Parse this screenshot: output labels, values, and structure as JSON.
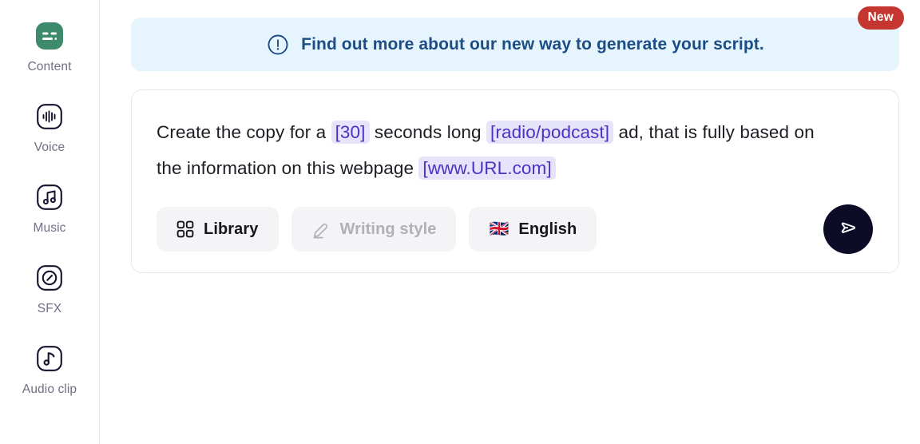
{
  "sidebar": {
    "items": [
      {
        "label": "Content",
        "icon": "content-icon",
        "active": true
      },
      {
        "label": "Voice",
        "icon": "voice-icon",
        "active": false
      },
      {
        "label": "Music",
        "icon": "music-icon",
        "active": false
      },
      {
        "label": "SFX",
        "icon": "sfx-icon",
        "active": false
      },
      {
        "label": "Audio clip",
        "icon": "audio-clip-icon",
        "active": false
      }
    ]
  },
  "banner": {
    "icon": "exclamation-circle-icon",
    "text": "Find out more about our new way to generate your script.",
    "badge": "New",
    "background_color": "#e6f4fd",
    "text_color": "#1c4d85",
    "badge_color": "#c4362f"
  },
  "prompt": {
    "segments": [
      {
        "text": "Create the copy for a ",
        "highlight": false
      },
      {
        "text": "[30]",
        "highlight": true
      },
      {
        "text": " seconds long ",
        "highlight": false
      },
      {
        "text": "[radio/podcast]",
        "highlight": true
      },
      {
        "text": " ad, that is fully based on the information on this webpage ",
        "highlight": false
      },
      {
        "text": "[www.URL.com]",
        "highlight": true
      }
    ],
    "highlight_bg": "#e6e4fb",
    "highlight_fg": "#4b32c3"
  },
  "toolbar": {
    "library_label": "Library",
    "library_icon": "grid-icon",
    "writing_style_label": "Writing style",
    "writing_style_icon": "pencil-icon",
    "language_label": "English",
    "language_flag": "🇬🇧",
    "send_icon": "send-icon",
    "send_button_color": "#0d0c26"
  }
}
